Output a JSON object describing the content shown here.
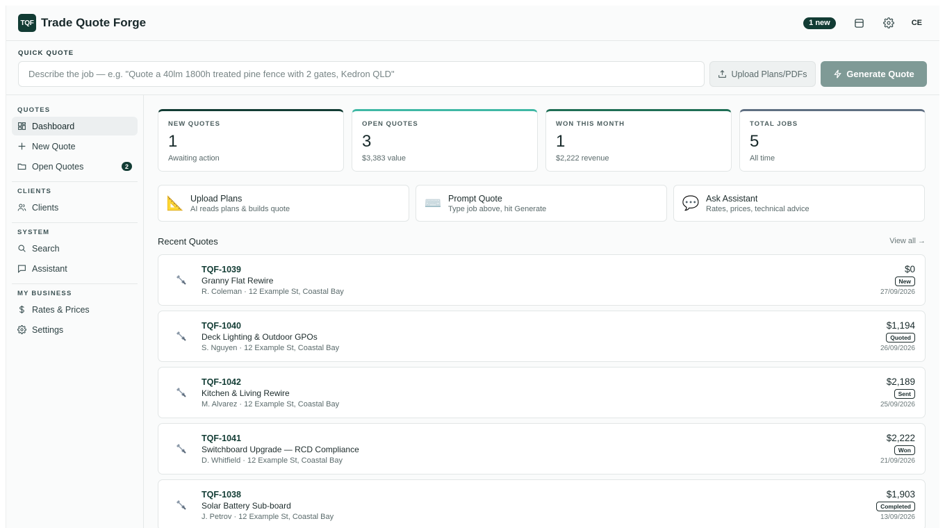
{
  "app": {
    "logo": "TQF",
    "title": "Trade Quote Forge"
  },
  "header": {
    "badge": "1 new",
    "avatar": "CE"
  },
  "quick_quote": {
    "label": "QUICK QUOTE",
    "placeholder": "Describe the job — e.g. \"Quote a 40lm 1800h treated pine fence with 2 gates, Kedron QLD\"",
    "upload_label": "Upload Plans/PDFs",
    "generate_label": "Generate Quote"
  },
  "sidebar": {
    "groups": [
      {
        "label": "QUOTES",
        "items": [
          {
            "label": "Dashboard",
            "icon": "dashboard-icon"
          },
          {
            "label": "New Quote",
            "icon": "plus-icon"
          },
          {
            "label": "Open Quotes",
            "icon": "folder-icon",
            "count": "2"
          }
        ]
      },
      {
        "label": "CLIENTS",
        "items": [
          {
            "label": "Clients",
            "icon": "users-icon"
          }
        ]
      },
      {
        "label": "SYSTEM",
        "items": [
          {
            "label": "Search",
            "icon": "search-icon"
          },
          {
            "label": "Assistant",
            "icon": "chat-icon"
          }
        ]
      },
      {
        "label": "MY BUSINESS",
        "items": [
          {
            "label": "Rates & Prices",
            "icon": "dollar-icon"
          },
          {
            "label": "Settings",
            "icon": "gear-icon"
          }
        ]
      }
    ]
  },
  "stats": [
    {
      "label": "NEW QUOTES",
      "value": "1",
      "sub": "Awaiting action",
      "accent": "#123c34"
    },
    {
      "label": "OPEN QUOTES",
      "value": "3",
      "sub": "$3,383 value",
      "accent": "#3fb8a4"
    },
    {
      "label": "WON THIS MONTH",
      "value": "1",
      "sub": "$2,222 revenue",
      "accent": "#1f6e55"
    },
    {
      "label": "TOTAL JOBS",
      "value": "5",
      "sub": "All time",
      "accent": "#5f6f82"
    }
  ],
  "actions": [
    {
      "title": "Upload Plans",
      "sub": "AI reads plans & builds quote",
      "icon": "📐"
    },
    {
      "title": "Prompt Quote",
      "sub": "Type job above, hit Generate",
      "icon": "⌨️"
    },
    {
      "title": "Ask Assistant",
      "sub": "Rates, prices, technical advice",
      "icon": "💬"
    }
  ],
  "recent": {
    "title": "Recent Quotes",
    "view_all": "View all →",
    "quotes": [
      {
        "id": "TQF-1039",
        "title": "Granny Flat Rewire",
        "client": "R. Coleman · 12 Example St, Coastal Bay",
        "amount": "$0",
        "status": "New",
        "date": "27/09/2026"
      },
      {
        "id": "TQF-1040",
        "title": "Deck Lighting & Outdoor GPOs",
        "client": "S. Nguyen · 12 Example St, Coastal Bay",
        "amount": "$1,194",
        "status": "Quoted",
        "date": "26/09/2026"
      },
      {
        "id": "TQF-1042",
        "title": "Kitchen & Living Rewire",
        "client": "M. Alvarez · 12 Example St, Coastal Bay",
        "amount": "$2,189",
        "status": "Sent",
        "date": "25/09/2026"
      },
      {
        "id": "TQF-1041",
        "title": "Switchboard Upgrade — RCD Compliance",
        "client": "D. Whitfield · 12 Example St, Coastal Bay",
        "amount": "$2,222",
        "status": "Won",
        "date": "21/09/2026"
      },
      {
        "id": "TQF-1038",
        "title": "Solar Battery Sub-board",
        "client": "J. Petrov · 12 Example St, Coastal Bay",
        "amount": "$1,903",
        "status": "Completed",
        "date": "13/09/2026"
      }
    ]
  }
}
